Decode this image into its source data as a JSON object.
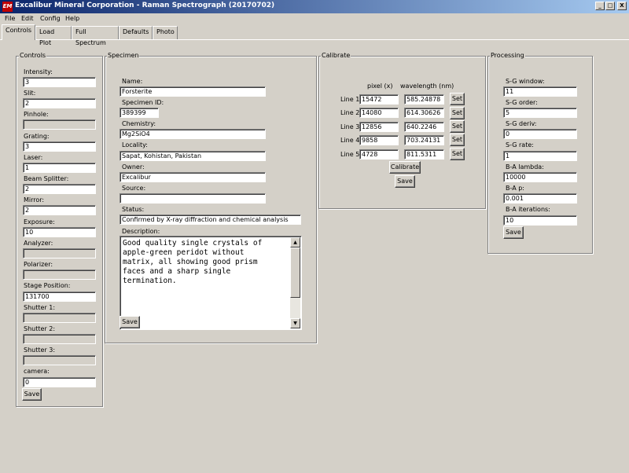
{
  "window": {
    "title": "Excalibur Mineral Corporation - Raman Spectrograph (20170702)",
    "icon_text": "EM",
    "minimize": "_",
    "maximize": "□",
    "close": "X"
  },
  "menu": [
    "File",
    "Edit",
    "Config",
    "Help"
  ],
  "tabs": [
    "Controls",
    "Load Plot",
    "Full Spectrum",
    "Defaults",
    "Photo"
  ],
  "active_tab": "Controls",
  "controls": {
    "title": "Controls",
    "fields": [
      {
        "label": "Intensity:",
        "value": "3"
      },
      {
        "label": "Slit:",
        "value": "2"
      },
      {
        "label": "Pinhole:",
        "value": ""
      },
      {
        "label": "Grating:",
        "value": "3"
      },
      {
        "label": "Laser:",
        "value": "1"
      },
      {
        "label": "Beam Splitter:",
        "value": "2"
      },
      {
        "label": "Mirror:",
        "value": "2"
      },
      {
        "label": "Exposure:",
        "value": "10"
      },
      {
        "label": "Analyzer:",
        "value": ""
      },
      {
        "label": "Polarizer:",
        "value": ""
      },
      {
        "label": "Stage Position:",
        "value": "131700"
      },
      {
        "label": "Shutter 1:",
        "value": ""
      },
      {
        "label": "Shutter 2:",
        "value": ""
      },
      {
        "label": "Shutter 3:",
        "value": ""
      },
      {
        "label": "camera:",
        "value": "0"
      }
    ],
    "save_label": "Save"
  },
  "specimen": {
    "title": "Specimen",
    "fields": [
      {
        "label": "Name:",
        "value": "Forsterite"
      },
      {
        "label": "Specimen ID:",
        "value": "389399"
      },
      {
        "label": "Chemistry:",
        "value": "Mg2SiO4"
      },
      {
        "label": "Locality:",
        "value": "Sapat, Kohistan, Pakistan"
      },
      {
        "label": "Owner:",
        "value": "Excalibur"
      },
      {
        "label": "Source:",
        "value": ""
      },
      {
        "label": "Status:",
        "value": "Confirmed by X-ray diffraction and chemical analysis"
      }
    ],
    "description_label": "Description:",
    "description": "Good quality single crystals of\napple-green peridot without\nmatrix, all showing good prism\nfaces and a sharp single\ntermination.",
    "save_label": "Save"
  },
  "calibrate": {
    "title": "Calibrate",
    "col_pixel": "pixel (x)",
    "col_wavelength": "wavelength (nm)",
    "lines": [
      {
        "label": "Line 1",
        "pixel": "15472",
        "wavelength": "585.24878",
        "set": "Set"
      },
      {
        "label": "Line 2",
        "pixel": "14080",
        "wavelength": "614.30626",
        "set": "Set"
      },
      {
        "label": "Line 3",
        "pixel": "12856",
        "wavelength": "640.2246",
        "set": "Set"
      },
      {
        "label": "Line 4",
        "pixel": "9858",
        "wavelength": "703.24131",
        "set": "Set"
      },
      {
        "label": "Line 5",
        "pixel": "4728",
        "wavelength": "811.5311",
        "set": "Set"
      }
    ],
    "calibrate_label": "Calibrate",
    "save_label": "Save"
  },
  "processing": {
    "title": "Processing",
    "fields": [
      {
        "label": "S-G window:",
        "value": "11"
      },
      {
        "label": "S-G order:",
        "value": "5"
      },
      {
        "label": "S-G deriv:",
        "value": "0"
      },
      {
        "label": "S-G rate:",
        "value": "1"
      },
      {
        "label": "B-A lambda:",
        "value": "10000"
      },
      {
        "label": "B-A p:",
        "value": "0.001"
      },
      {
        "label": "B-A iterations:",
        "value": "10"
      }
    ],
    "save_label": "Save"
  }
}
